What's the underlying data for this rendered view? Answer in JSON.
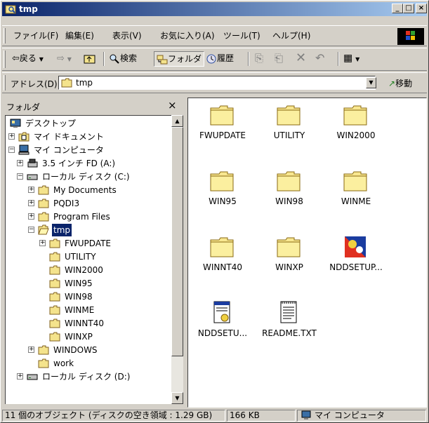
{
  "window": {
    "title": "tmp",
    "min_label": "_",
    "max_label": "□",
    "close_label": "×"
  },
  "menu": {
    "items": [
      {
        "label": "ファイル(F)"
      },
      {
        "label": "編集(E)"
      },
      {
        "label": "表示(V)"
      },
      {
        "label": "お気に入り(A)"
      },
      {
        "label": "ツール(T)"
      },
      {
        "label": "ヘルプ(H)"
      }
    ]
  },
  "toolbar": {
    "back_label": "戻る",
    "search_label": "検索",
    "folders_label": "フォルダ",
    "history_label": "履歴"
  },
  "address": {
    "label": "アドレス(D)",
    "value": "tmp",
    "go_label": "移動"
  },
  "folder_pane": {
    "title": "フォルダ",
    "close_label": "×",
    "tree": [
      {
        "label": "デスクトップ",
        "depth": 0,
        "icon": "desktop-icon",
        "expander": ""
      },
      {
        "label": "マイ ドキュメント",
        "depth": 1,
        "icon": "my-documents-icon",
        "expander": "+"
      },
      {
        "label": "マイ コンピュータ",
        "depth": 1,
        "icon": "my-computer-icon",
        "expander": "-"
      },
      {
        "label": "3.5 インチ FD (A:)",
        "depth": 2,
        "icon": "floppy-icon",
        "expander": "+"
      },
      {
        "label": "ローカル ディスク (C:)",
        "depth": 2,
        "icon": "hard-disk-icon",
        "expander": "-"
      },
      {
        "label": "My Documents",
        "depth": 3,
        "icon": "folder-icon",
        "expander": "+"
      },
      {
        "label": "PQDI3",
        "depth": 3,
        "icon": "folder-icon",
        "expander": "+"
      },
      {
        "label": "Program Files",
        "depth": 3,
        "icon": "folder-icon",
        "expander": "+"
      },
      {
        "label": "tmp",
        "depth": 3,
        "icon": "open-folder-icon",
        "expander": "-",
        "selected": true
      },
      {
        "label": "FWUPDATE",
        "depth": 4,
        "icon": "folder-icon",
        "expander": "+"
      },
      {
        "label": "UTILITY",
        "depth": 4,
        "icon": "folder-icon",
        "expander": ""
      },
      {
        "label": "WIN2000",
        "depth": 4,
        "icon": "folder-icon",
        "expander": ""
      },
      {
        "label": "WIN95",
        "depth": 4,
        "icon": "folder-icon",
        "expander": ""
      },
      {
        "label": "WIN98",
        "depth": 4,
        "icon": "folder-icon",
        "expander": ""
      },
      {
        "label": "WINME",
        "depth": 4,
        "icon": "folder-icon",
        "expander": ""
      },
      {
        "label": "WINNT40",
        "depth": 4,
        "icon": "folder-icon",
        "expander": ""
      },
      {
        "label": "WINXP",
        "depth": 4,
        "icon": "folder-icon",
        "expander": ""
      },
      {
        "label": "WINDOWS",
        "depth": 3,
        "icon": "folder-icon",
        "expander": "+"
      },
      {
        "label": "work",
        "depth": 3,
        "icon": "folder-icon",
        "expander": ""
      },
      {
        "label": "ローカル ディスク (D:)",
        "depth": 2,
        "icon": "hard-disk-icon",
        "expander": "+"
      }
    ]
  },
  "files": [
    {
      "label": "FWUPDATE",
      "icon": "folder-icon"
    },
    {
      "label": "UTILITY",
      "icon": "folder-icon"
    },
    {
      "label": "WIN2000",
      "icon": "folder-icon"
    },
    {
      "label": "WIN95",
      "icon": "folder-icon"
    },
    {
      "label": "WIN98",
      "icon": "folder-icon"
    },
    {
      "label": "WINME",
      "icon": "folder-icon"
    },
    {
      "label": "WINNT40",
      "icon": "folder-icon"
    },
    {
      "label": "WINXP",
      "icon": "folder-icon"
    },
    {
      "label": "NDDSETUP...",
      "icon": "setup-program-icon"
    },
    {
      "label": "NDDSETU...",
      "icon": "settings-file-icon"
    },
    {
      "label": "README.TXT",
      "icon": "text-file-icon"
    }
  ],
  "status": {
    "objects": "11 個のオブジェクト (ディスクの空き領域 : 1.29 GB)",
    "size": "166 KB",
    "zone": "マイ コンピュータ"
  }
}
